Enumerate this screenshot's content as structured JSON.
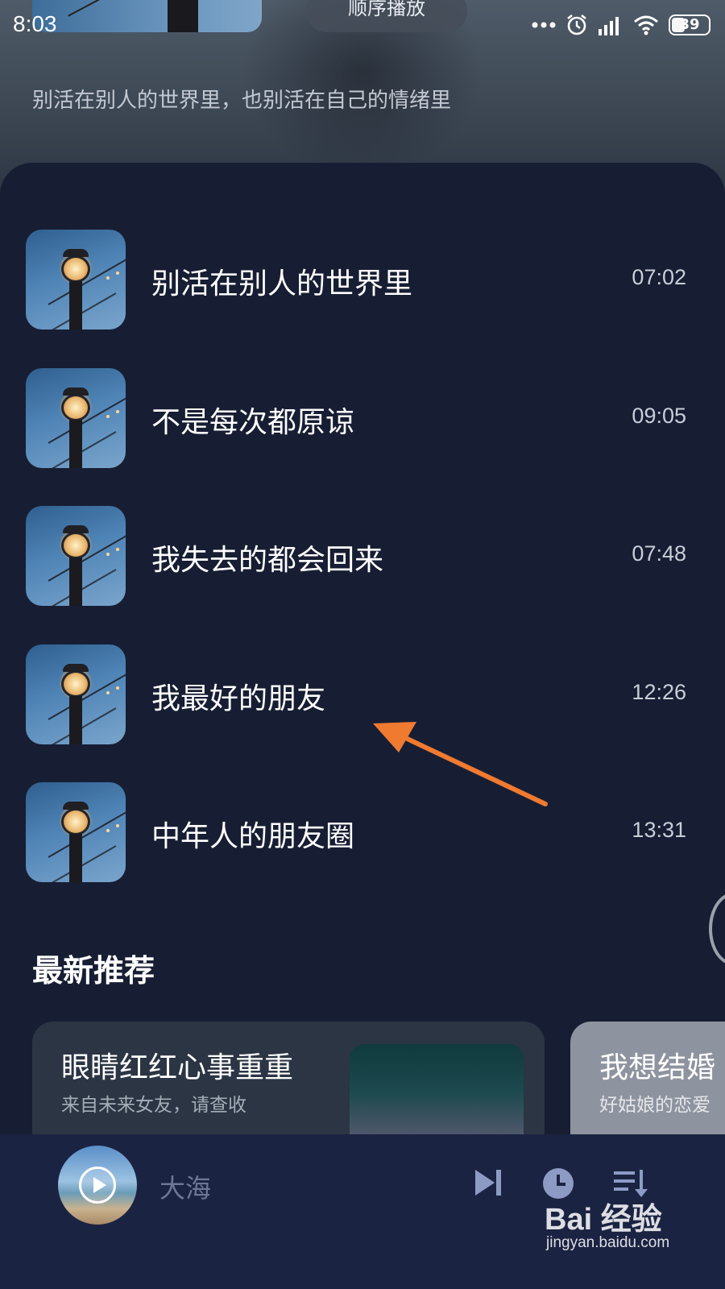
{
  "status_bar": {
    "time": "8:03",
    "battery": "39",
    "icons": [
      "more-dots-icon",
      "alarm-icon",
      "signal-icon",
      "wifi-icon",
      "battery-icon"
    ]
  },
  "header": {
    "order_mode": "顺序播放",
    "subtitle": "别活在别人的世界里，也别活在自己的情绪里"
  },
  "playlist": {
    "tracks": [
      {
        "title": "别活在别人的世界里",
        "duration": "07:02"
      },
      {
        "title": "不是每次都原谅",
        "duration": "09:05"
      },
      {
        "title": "我失去的都会回来",
        "duration": "07:48"
      },
      {
        "title": "我最好的朋友",
        "duration": "12:26"
      },
      {
        "title": "中年人的朋友圈",
        "duration": "13:31"
      }
    ]
  },
  "recommend": {
    "section_title": "最新推荐",
    "cards": [
      {
        "title": "眼睛红红心事重重",
        "subtitle": "来自未来女友，请查收"
      },
      {
        "title": "我想结婚",
        "subtitle": "好姑娘的恋爱"
      }
    ]
  },
  "player": {
    "now_playing": "大海",
    "icons": [
      "play-icon",
      "next-track-icon",
      "timer-clock-icon",
      "playlist-icon"
    ]
  },
  "watermark": {
    "logo": "Bai 经验",
    "url": "jingyan.baidu.com"
  },
  "colors": {
    "background": "#171e33",
    "player_bar": "#1b2342",
    "annotation_arrow": "#f07a30"
  }
}
